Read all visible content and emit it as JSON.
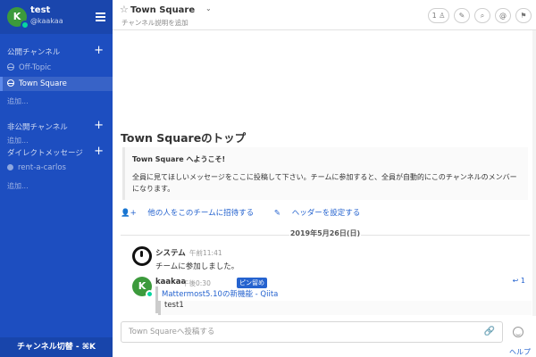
{
  "user": {
    "name": "test",
    "handle": "@kaakaa",
    "initial": "K"
  },
  "sidebar": {
    "public_title": "公開チャンネル",
    "public_channels": [
      {
        "label": "Off-Topic"
      },
      {
        "label": "Town Square"
      }
    ],
    "public_more": "追加...",
    "private_title": "非公開チャンネル",
    "private_more": "追加...",
    "dm_title": "ダイレクトメッセージ",
    "dm_channels": [
      {
        "label": "rent-a-carlos"
      }
    ],
    "dm_more": "追加...",
    "switcher": "チャンネル切替 - ⌘K"
  },
  "header": {
    "title": "Town Square",
    "purpose": "チャンネル説明を追加",
    "member_count": "1"
  },
  "intro": {
    "title": "Town Squareのトップ",
    "welcome": "Town Square へようこそ!",
    "body": "全員に見てほしいメッセージをここに投稿して下さい。チームに参加すると、全員が自動的にこのチャンネルのメンバーになります。",
    "invite": "他の人をこのチームに招待する",
    "set_header": "ヘッダーを設定する"
  },
  "date_separator": "2019年5月26日(日)",
  "posts": [
    {
      "author": "システム",
      "time": "午前11:41",
      "text": "チームに参加しました。"
    },
    {
      "author": "kaakaa",
      "time": "午後0:30",
      "badge": "ピン留め",
      "link": "Mattermost5.10の新機能 - Qiita",
      "quote": "test1",
      "reply_count": "1"
    }
  ],
  "composer": {
    "placeholder": "Town Squareへ投稿する"
  },
  "help": "ヘルプ"
}
